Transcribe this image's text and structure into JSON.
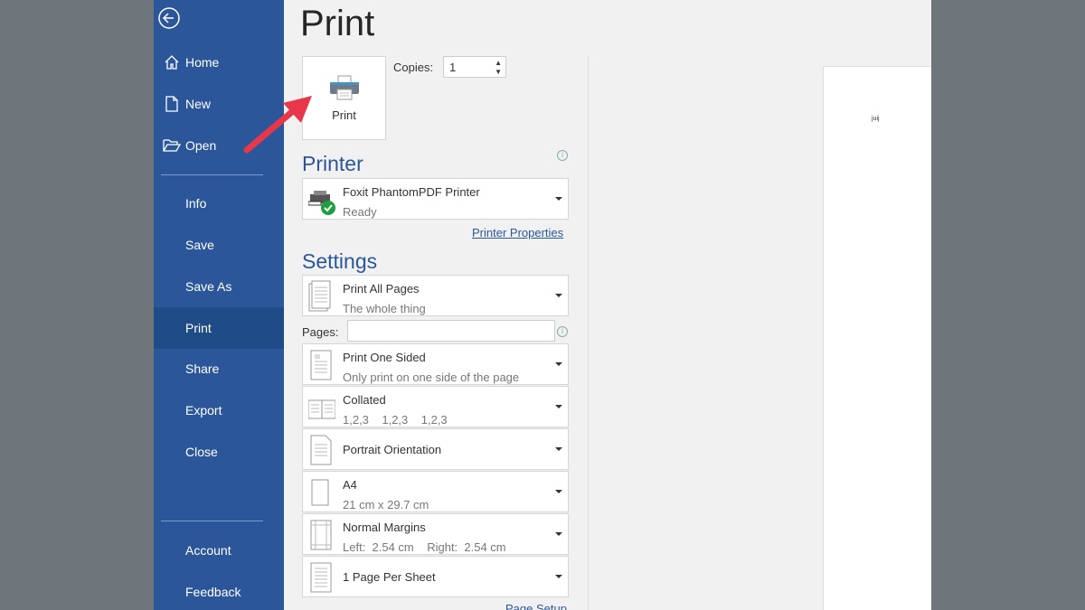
{
  "sidebar": {
    "back_icon": "arrow-left-circle-icon",
    "items": [
      {
        "label": "Home",
        "icon": "home-icon"
      },
      {
        "label": "New",
        "icon": "document-icon"
      },
      {
        "label": "Open",
        "icon": "folder-open-icon"
      },
      {
        "label": "Info"
      },
      {
        "label": "Save"
      },
      {
        "label": "Save As"
      },
      {
        "label": "Print",
        "selected": true
      },
      {
        "label": "Share"
      },
      {
        "label": "Export"
      },
      {
        "label": "Close"
      },
      {
        "label": "Account"
      },
      {
        "label": "Feedback"
      }
    ]
  },
  "main": {
    "title": "Print",
    "print_button": "Print",
    "copies_label": "Copies:",
    "copies_value": "1",
    "printer_heading": "Printer",
    "printer": {
      "name": "Foxit PhantomPDF Printer",
      "status": "Ready"
    },
    "printer_properties": "Printer Properties",
    "settings_heading": "Settings",
    "pages_label": "Pages:",
    "settings": [
      {
        "title": "Print All Pages",
        "sub": "The whole thing"
      },
      {
        "title": "Print One Sided",
        "sub": "Only print on one side of the page"
      },
      {
        "title": "Collated",
        "sub": "1,2,3    1,2,3    1,2,3"
      },
      {
        "title": "Portrait Orientation",
        "sub": ""
      },
      {
        "title": "A4",
        "sub": "21 cm x 29.7 cm"
      },
      {
        "title": "Normal Margins",
        "sub": "Left:  2.54 cm    Right:  2.54 cm"
      },
      {
        "title": "1 Page Per Sheet",
        "sub": ""
      }
    ],
    "page_setup": "Page Setup",
    "preview_text": "juij"
  },
  "colors": {
    "sidebar": "#2b579a",
    "selected": "#1f4b86",
    "annotation_arrow": "#e8374a"
  }
}
